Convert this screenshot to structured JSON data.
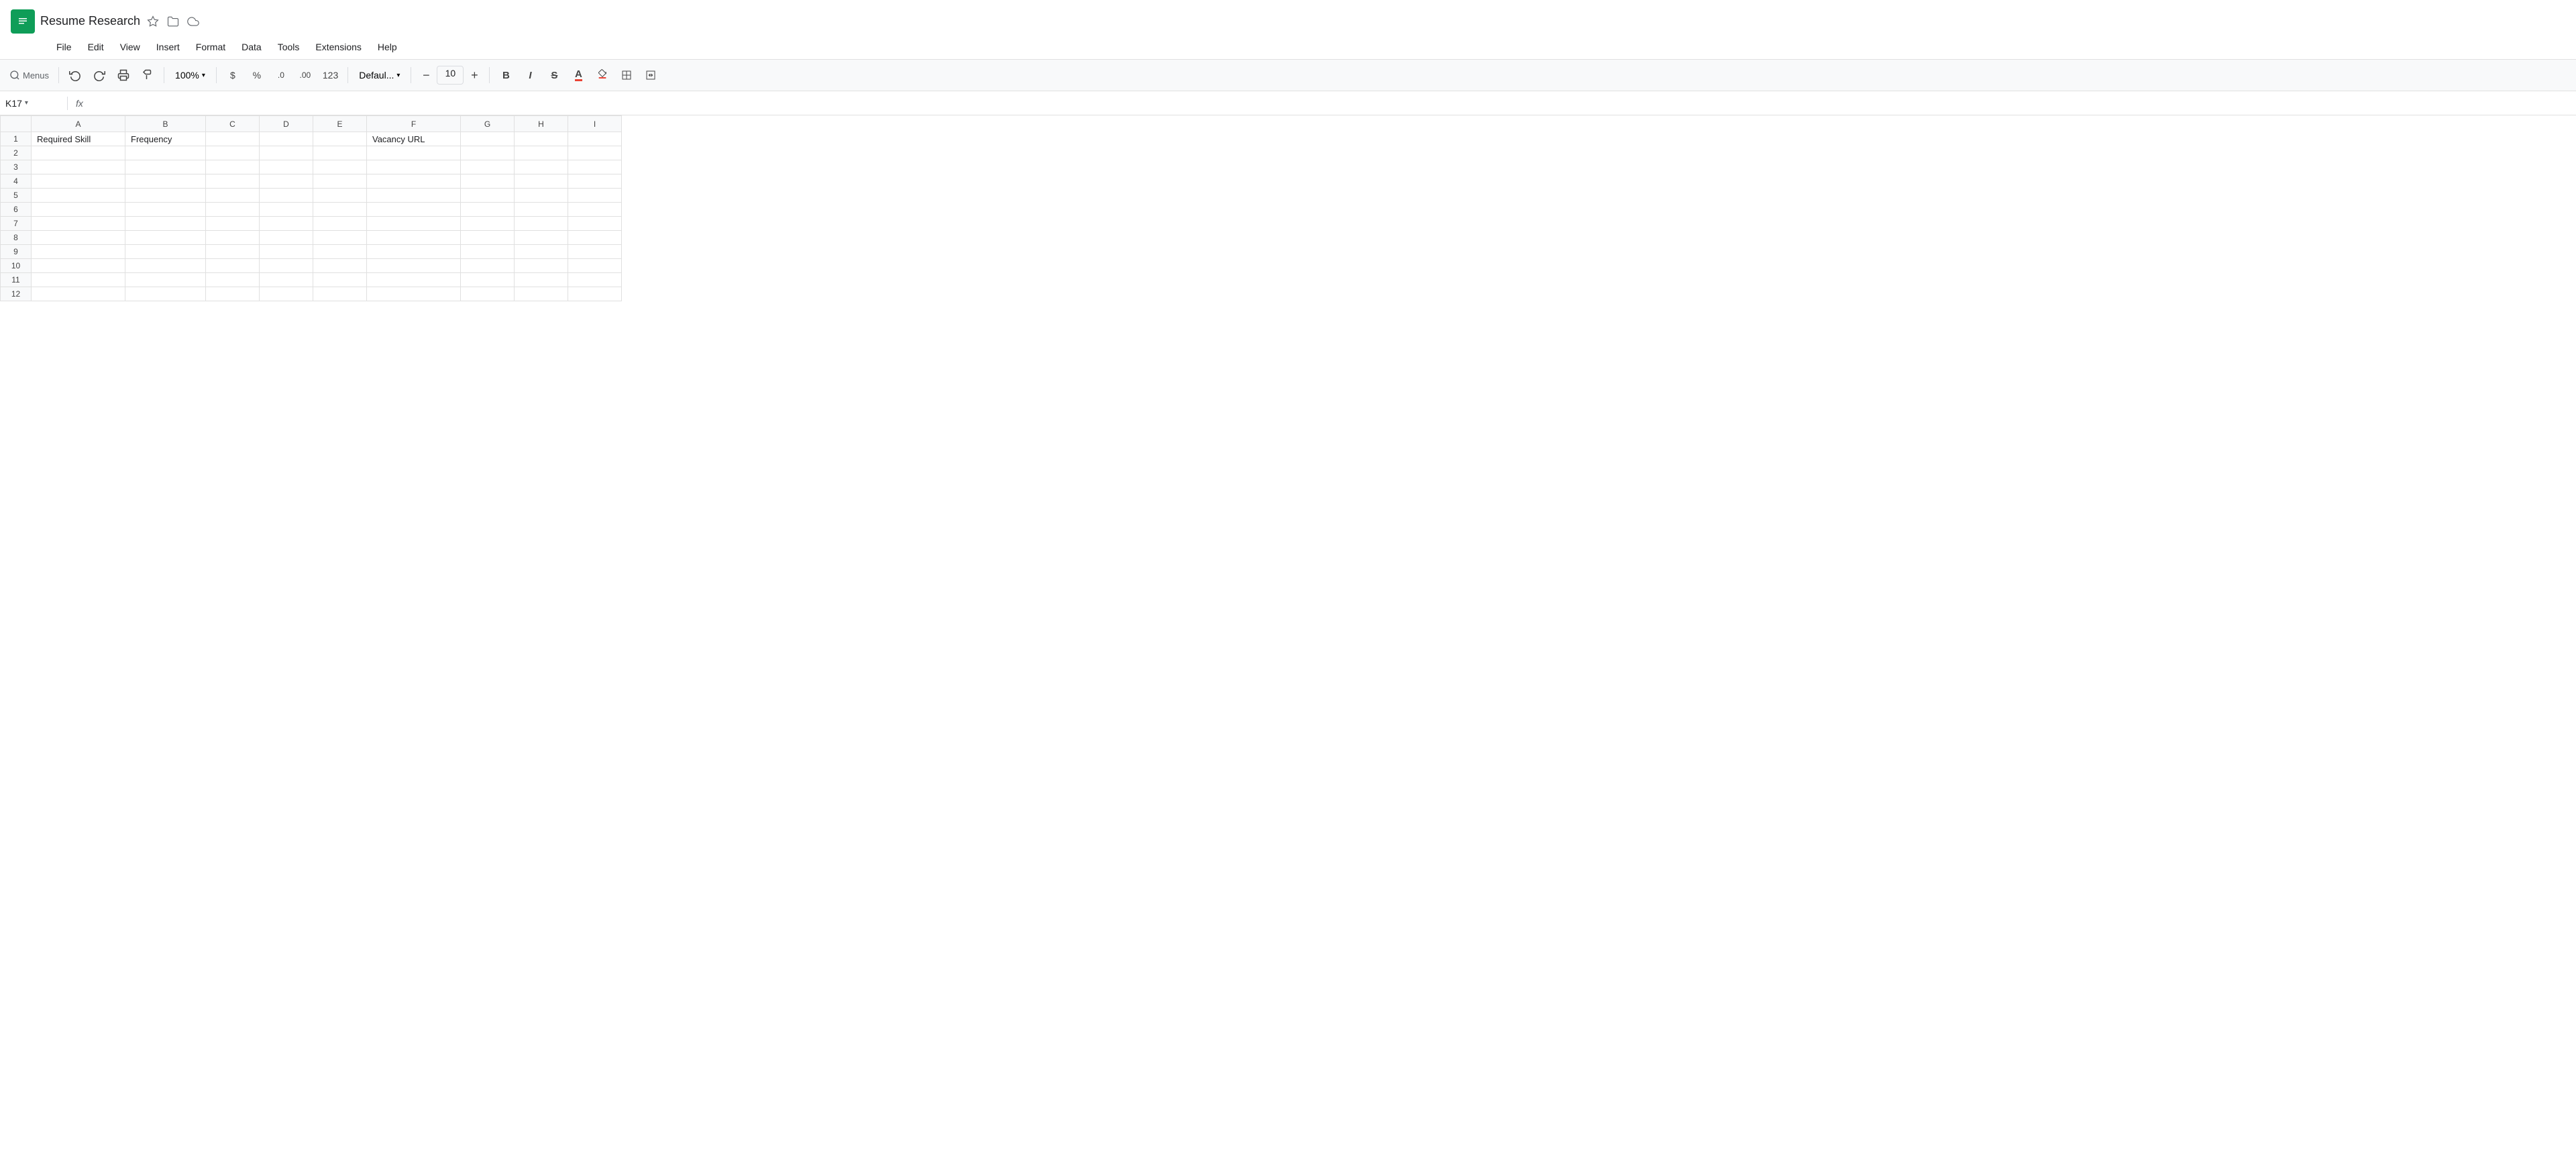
{
  "app": {
    "icon_color": "#0f9d58",
    "title": "Resume Research",
    "star_icon": "★",
    "folder_icon": "📁",
    "cloud_icon": "☁"
  },
  "menu": {
    "items": [
      "File",
      "Edit",
      "View",
      "Insert",
      "Format",
      "Data",
      "Tools",
      "Extensions",
      "Help"
    ]
  },
  "toolbar": {
    "search_placeholder": "Menus",
    "undo_label": "↩",
    "redo_label": "↪",
    "print_label": "🖨",
    "paint_label": "🖌",
    "zoom_label": "100%",
    "zoom_arrow": "▾",
    "currency_label": "$",
    "percent_label": "%",
    "decimal_dec": ".0",
    "decimal_inc": ".00",
    "format_123": "123",
    "font_label": "Defaul...",
    "font_arrow": "▾",
    "font_size_minus": "−",
    "font_size_value": "10",
    "font_size_plus": "+",
    "bold_label": "B",
    "italic_label": "I",
    "strikethrough_label": "S",
    "text_color_label": "A",
    "fill_color_label": "◆",
    "borders_label": "⊞",
    "merge_label": "⊟"
  },
  "formula_bar": {
    "cell_ref": "K17",
    "dropdown_arrow": "▾",
    "fx_label": "fx"
  },
  "columns": {
    "row_header": "",
    "headers": [
      "A",
      "B",
      "C",
      "D",
      "E",
      "F",
      "G",
      "H",
      "I"
    ]
  },
  "rows": {
    "count": 12,
    "data": [
      {
        "num": 1,
        "cells": {
          "A": "Required Skill",
          "B": "Frequency",
          "C": "",
          "D": "",
          "E": "",
          "F": "Vacancy URL",
          "G": "",
          "H": "",
          "I": ""
        }
      },
      {
        "num": 2,
        "cells": {
          "A": "",
          "B": "",
          "C": "",
          "D": "",
          "E": "",
          "F": "",
          "G": "",
          "H": "",
          "I": ""
        }
      },
      {
        "num": 3,
        "cells": {
          "A": "",
          "B": "",
          "C": "",
          "D": "",
          "E": "",
          "F": "",
          "G": "",
          "H": "",
          "I": ""
        }
      },
      {
        "num": 4,
        "cells": {
          "A": "",
          "B": "",
          "C": "",
          "D": "",
          "E": "",
          "F": "",
          "G": "",
          "H": "",
          "I": ""
        }
      },
      {
        "num": 5,
        "cells": {
          "A": "",
          "B": "",
          "C": "",
          "D": "",
          "E": "",
          "F": "",
          "G": "",
          "H": "",
          "I": ""
        }
      },
      {
        "num": 6,
        "cells": {
          "A": "",
          "B": "",
          "C": "",
          "D": "",
          "E": "",
          "F": "",
          "G": "",
          "H": "",
          "I": ""
        }
      },
      {
        "num": 7,
        "cells": {
          "A": "",
          "B": "",
          "C": "",
          "D": "",
          "E": "",
          "F": "",
          "G": "",
          "H": "",
          "I": ""
        }
      },
      {
        "num": 8,
        "cells": {
          "A": "",
          "B": "",
          "C": "",
          "D": "",
          "E": "",
          "F": "",
          "G": "",
          "H": "",
          "I": ""
        }
      },
      {
        "num": 9,
        "cells": {
          "A": "",
          "B": "",
          "C": "",
          "D": "",
          "E": "",
          "F": "",
          "G": "",
          "H": "",
          "I": ""
        }
      },
      {
        "num": 10,
        "cells": {
          "A": "",
          "B": "",
          "C": "",
          "D": "",
          "E": "",
          "F": "",
          "G": "",
          "H": "",
          "I": ""
        }
      },
      {
        "num": 11,
        "cells": {
          "A": "",
          "B": "",
          "C": "",
          "D": "",
          "E": "",
          "F": "",
          "G": "",
          "H": "",
          "I": ""
        }
      },
      {
        "num": 12,
        "cells": {
          "A": "",
          "B": "",
          "C": "",
          "D": "",
          "E": "",
          "F": "",
          "G": "",
          "H": "",
          "I": ""
        }
      }
    ]
  }
}
